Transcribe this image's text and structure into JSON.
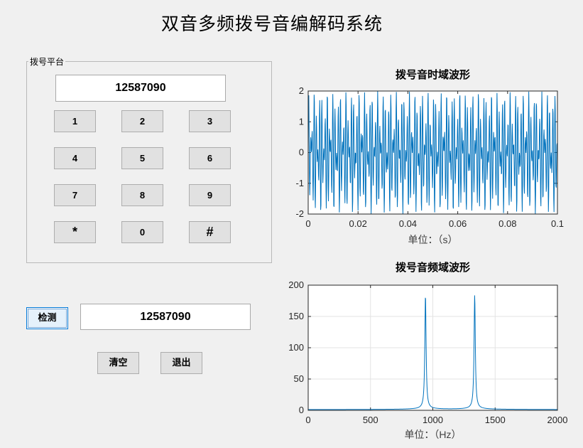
{
  "app": {
    "title": "双音多频拨号音编解码系统"
  },
  "dial_panel": {
    "legend": "拨号平台",
    "display_value": "12587090",
    "keys": [
      {
        "label": "1"
      },
      {
        "label": "2"
      },
      {
        "label": "3"
      },
      {
        "label": "4"
      },
      {
        "label": "5"
      },
      {
        "label": "6"
      },
      {
        "label": "7"
      },
      {
        "label": "8"
      },
      {
        "label": "9"
      },
      {
        "label": "*"
      },
      {
        "label": "0"
      },
      {
        "label": "#"
      }
    ]
  },
  "detect": {
    "button_label": "检测",
    "result_value": "12587090"
  },
  "actions": {
    "clear_label": "清空",
    "exit_label": "退出"
  },
  "colors": {
    "series": "#0072bd",
    "background": "#f0f0f0",
    "axes_bg": "#ffffff"
  },
  "chart_data": [
    {
      "type": "line",
      "title": "拨号音时域波形",
      "xlabel": "单位：（s）",
      "ylabel": "",
      "xlim": [
        0,
        0.1
      ],
      "ylim": [
        -2,
        2
      ],
      "xticks": [
        "0",
        "0.02",
        "0.04",
        "0.06",
        "0.08",
        "0.1"
      ],
      "yticks": [
        "-2",
        "-1",
        "0",
        "1",
        "2"
      ],
      "grid": false,
      "series": [
        {
          "signal": "sum of two sinusoids",
          "f1_hz": 941,
          "f2_hz": 1336,
          "amplitude_each": 1,
          "samples": 800
        }
      ]
    },
    {
      "type": "line",
      "title": "拨号音频域波形",
      "xlabel": "单位：（Hz）",
      "ylabel": "",
      "xlim": [
        0,
        2000
      ],
      "ylim": [
        0,
        200
      ],
      "xticks": [
        "0",
        "500",
        "1000",
        "1500",
        "2000"
      ],
      "yticks": [
        "0",
        "50",
        "100",
        "150",
        "200"
      ],
      "grid": true,
      "series": [
        {
          "peaks_hz": [
            941,
            1336
          ],
          "peak_value_exceeds": 200,
          "baseline_near_0": 1
        }
      ]
    }
  ]
}
